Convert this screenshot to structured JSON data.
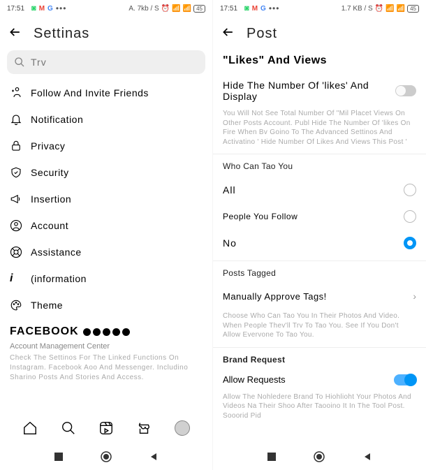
{
  "status": {
    "time": "17:51",
    "net_left": "A. 7kb / S",
    "net_right": "1.7 KB / S",
    "batt": "45"
  },
  "left": {
    "title": "Settinas",
    "search_placeholder": "Trv",
    "menu": {
      "follow": "Follow And Invite Friends",
      "notif": "Notification",
      "privacy": "Privacy",
      "security": "Security",
      "insertion": "Insertion",
      "account": "Account",
      "assist": "Assistance",
      "info": "(information",
      "theme": "Theme"
    },
    "fb": {
      "title": "FACEBOOK",
      "link": "Account Management Center",
      "desc": "Check The Settinos For The Linked Functions On Instagram. Facebook Aoo And Messenger. Includino Sharino Posts And Stories And Access."
    }
  },
  "right": {
    "title": "Post",
    "section": "\"Likes\" And Views",
    "hide_title": "Hide The Number Of 'likes' And Display",
    "hide_desc": "You Will Not See Total Number Of \"Mil Placet Views On Other Posts Account. Publ Hide The Number Of 'likes On Fire When Bv Goino To The Advanced Settinos And Activatino ' Hide Number Of Likes And Views This Post '",
    "tag_head": "Who Can Tao You",
    "tag_all": "All",
    "tag_follow": "People You Follow",
    "tag_no": "No",
    "posts_tagged": "Posts Tagged",
    "approve": "Manually Approve Tags!",
    "approve_desc": "Choose Who Can Tao You In Their Photos And Video. When People Thev'll Trv To Tao You. See If You Don't Allow Evervone To Tao You.",
    "brand": "Brand Request",
    "allow": "Allow Requests",
    "allow_desc": "Allow The Nohledere Brand To Hiohlioht Your Photos And Videos Na Their Shoo After Taooino It In The Tool Post. Sooorid Pid"
  }
}
